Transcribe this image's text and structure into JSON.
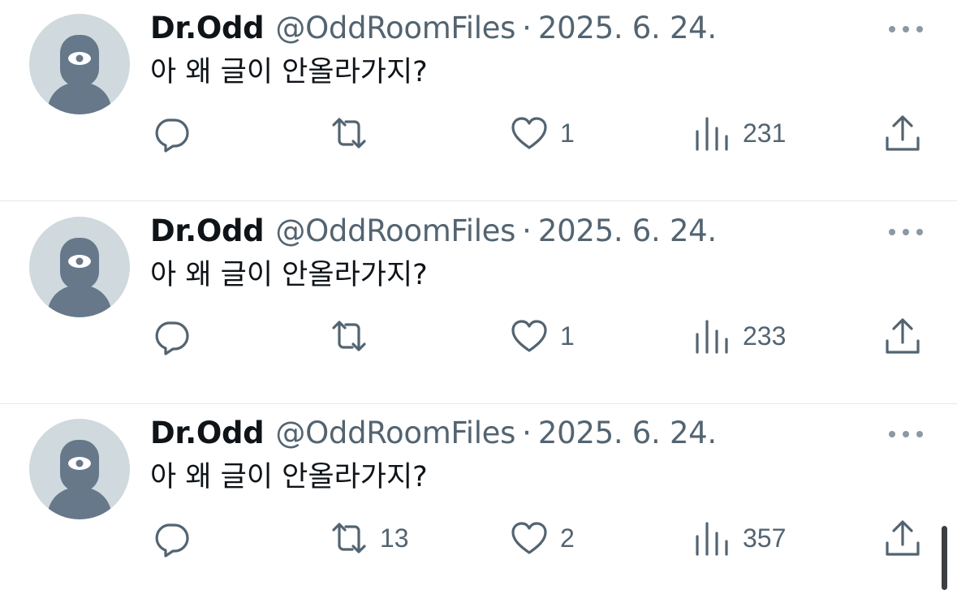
{
  "feed": {
    "tweets": [
      {
        "author_name": "Dr.Odd",
        "handle": "@OddRoomFiles",
        "separator": "·",
        "date": "2025. 6. 24.",
        "text": "아 왜 글이 안올라가지?",
        "replies": "",
        "retweets": "",
        "likes": "1",
        "views": "231"
      },
      {
        "author_name": "Dr.Odd",
        "handle": "@OddRoomFiles",
        "separator": "·",
        "date": "2025. 6. 24.",
        "text": "아 왜 글이 안올라가지?",
        "replies": "",
        "retweets": "",
        "likes": "1",
        "views": "233"
      },
      {
        "author_name": "Dr.Odd",
        "handle": "@OddRoomFiles",
        "separator": "·",
        "date": "2025. 6. 24.",
        "text": "아 왜 글이 안올라가지?",
        "replies": "",
        "retweets": "13",
        "likes": "2",
        "views": "357"
      }
    ]
  },
  "icons": {
    "avatar": "default-avatar-icon",
    "more": "more-options-icon",
    "reply": "reply-icon",
    "retweet": "retweet-icon",
    "like": "heart-icon",
    "views": "views-icon",
    "share": "share-icon"
  },
  "colors": {
    "primary_text": "#0f1419",
    "secondary_text": "#536471",
    "avatar_bg": "#cfd9de",
    "divider": "#e6e8ea"
  }
}
